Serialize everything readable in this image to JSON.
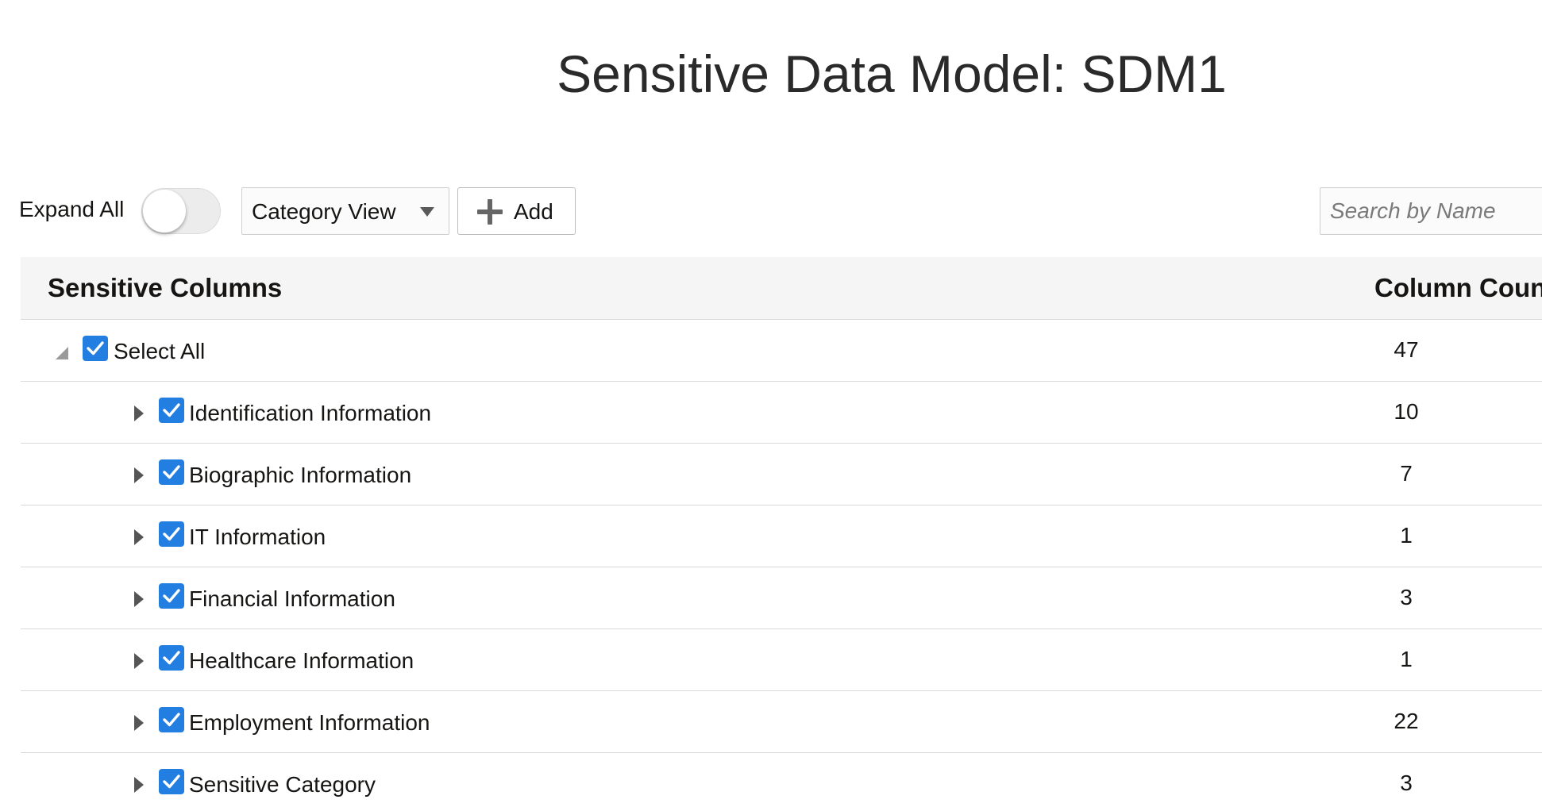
{
  "page": {
    "title": "Sensitive Data Model: SDM1"
  },
  "toolbar": {
    "expand_all_label": "Expand All",
    "expand_all_on": false,
    "view_select_value": "Category View",
    "add_label": "Add",
    "search_placeholder": "Search by Name",
    "search_value": ""
  },
  "table": {
    "headers": {
      "name": "Sensitive Columns",
      "count": "Column Count"
    },
    "select_all": {
      "label": "Select All",
      "count": "47",
      "checked": true,
      "expanded": true
    },
    "rows": [
      {
        "label": "Identification Information",
        "count": "10",
        "checked": true
      },
      {
        "label": "Biographic Information",
        "count": "7",
        "checked": true
      },
      {
        "label": "IT Information",
        "count": "1",
        "checked": true
      },
      {
        "label": "Financial Information",
        "count": "3",
        "checked": true
      },
      {
        "label": "Healthcare Information",
        "count": "1",
        "checked": true
      },
      {
        "label": "Employment Information",
        "count": "22",
        "checked": true
      },
      {
        "label": "Sensitive Category",
        "count": "3",
        "checked": true
      }
    ]
  },
  "colors": {
    "checkbox_accent": "#227ee0",
    "header_background": "#f5f5f5",
    "row_divider": "#d9d9d9"
  },
  "icons": {
    "add": "plus-icon",
    "select_caret": "chevron-down-icon",
    "row_expand": "caret-right-icon",
    "row_collapse": "caret-down-icon",
    "checkbox": "checkmark-icon"
  }
}
